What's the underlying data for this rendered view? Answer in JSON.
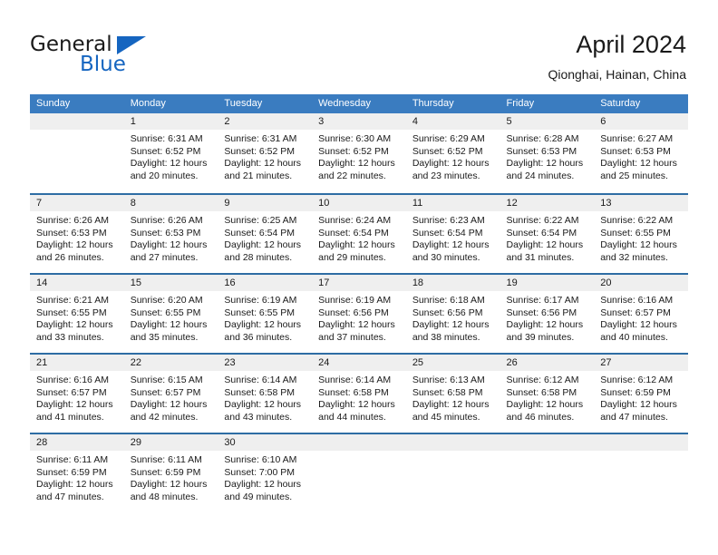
{
  "brand": {
    "name_primary": "General",
    "name_secondary": "Blue",
    "triangle_color": "#1565c0"
  },
  "header": {
    "title": "April 2024",
    "subtitle": "Qionghai, Hainan, China"
  },
  "theme": {
    "header_row_bg": "#3a7cc0",
    "week_separator": "#2e6da4",
    "day_number_bg": "#efefef",
    "text": "#1a1a1a"
  },
  "weekdays": [
    "Sunday",
    "Monday",
    "Tuesday",
    "Wednesday",
    "Thursday",
    "Friday",
    "Saturday"
  ],
  "weeks": [
    [
      {
        "day": "",
        "sunrise": "",
        "sunset": "",
        "daylight_line1": "",
        "daylight_line2": ""
      },
      {
        "day": "1",
        "sunrise": "Sunrise: 6:31 AM",
        "sunset": "Sunset: 6:52 PM",
        "daylight_line1": "Daylight: 12 hours",
        "daylight_line2": "and 20 minutes."
      },
      {
        "day": "2",
        "sunrise": "Sunrise: 6:31 AM",
        "sunset": "Sunset: 6:52 PM",
        "daylight_line1": "Daylight: 12 hours",
        "daylight_line2": "and 21 minutes."
      },
      {
        "day": "3",
        "sunrise": "Sunrise: 6:30 AM",
        "sunset": "Sunset: 6:52 PM",
        "daylight_line1": "Daylight: 12 hours",
        "daylight_line2": "and 22 minutes."
      },
      {
        "day": "4",
        "sunrise": "Sunrise: 6:29 AM",
        "sunset": "Sunset: 6:52 PM",
        "daylight_line1": "Daylight: 12 hours",
        "daylight_line2": "and 23 minutes."
      },
      {
        "day": "5",
        "sunrise": "Sunrise: 6:28 AM",
        "sunset": "Sunset: 6:53 PM",
        "daylight_line1": "Daylight: 12 hours",
        "daylight_line2": "and 24 minutes."
      },
      {
        "day": "6",
        "sunrise": "Sunrise: 6:27 AM",
        "sunset": "Sunset: 6:53 PM",
        "daylight_line1": "Daylight: 12 hours",
        "daylight_line2": "and 25 minutes."
      }
    ],
    [
      {
        "day": "7",
        "sunrise": "Sunrise: 6:26 AM",
        "sunset": "Sunset: 6:53 PM",
        "daylight_line1": "Daylight: 12 hours",
        "daylight_line2": "and 26 minutes."
      },
      {
        "day": "8",
        "sunrise": "Sunrise: 6:26 AM",
        "sunset": "Sunset: 6:53 PM",
        "daylight_line1": "Daylight: 12 hours",
        "daylight_line2": "and 27 minutes."
      },
      {
        "day": "9",
        "sunrise": "Sunrise: 6:25 AM",
        "sunset": "Sunset: 6:54 PM",
        "daylight_line1": "Daylight: 12 hours",
        "daylight_line2": "and 28 minutes."
      },
      {
        "day": "10",
        "sunrise": "Sunrise: 6:24 AM",
        "sunset": "Sunset: 6:54 PM",
        "daylight_line1": "Daylight: 12 hours",
        "daylight_line2": "and 29 minutes."
      },
      {
        "day": "11",
        "sunrise": "Sunrise: 6:23 AM",
        "sunset": "Sunset: 6:54 PM",
        "daylight_line1": "Daylight: 12 hours",
        "daylight_line2": "and 30 minutes."
      },
      {
        "day": "12",
        "sunrise": "Sunrise: 6:22 AM",
        "sunset": "Sunset: 6:54 PM",
        "daylight_line1": "Daylight: 12 hours",
        "daylight_line2": "and 31 minutes."
      },
      {
        "day": "13",
        "sunrise": "Sunrise: 6:22 AM",
        "sunset": "Sunset: 6:55 PM",
        "daylight_line1": "Daylight: 12 hours",
        "daylight_line2": "and 32 minutes."
      }
    ],
    [
      {
        "day": "14",
        "sunrise": "Sunrise: 6:21 AM",
        "sunset": "Sunset: 6:55 PM",
        "daylight_line1": "Daylight: 12 hours",
        "daylight_line2": "and 33 minutes."
      },
      {
        "day": "15",
        "sunrise": "Sunrise: 6:20 AM",
        "sunset": "Sunset: 6:55 PM",
        "daylight_line1": "Daylight: 12 hours",
        "daylight_line2": "and 35 minutes."
      },
      {
        "day": "16",
        "sunrise": "Sunrise: 6:19 AM",
        "sunset": "Sunset: 6:55 PM",
        "daylight_line1": "Daylight: 12 hours",
        "daylight_line2": "and 36 minutes."
      },
      {
        "day": "17",
        "sunrise": "Sunrise: 6:19 AM",
        "sunset": "Sunset: 6:56 PM",
        "daylight_line1": "Daylight: 12 hours",
        "daylight_line2": "and 37 minutes."
      },
      {
        "day": "18",
        "sunrise": "Sunrise: 6:18 AM",
        "sunset": "Sunset: 6:56 PM",
        "daylight_line1": "Daylight: 12 hours",
        "daylight_line2": "and 38 minutes."
      },
      {
        "day": "19",
        "sunrise": "Sunrise: 6:17 AM",
        "sunset": "Sunset: 6:56 PM",
        "daylight_line1": "Daylight: 12 hours",
        "daylight_line2": "and 39 minutes."
      },
      {
        "day": "20",
        "sunrise": "Sunrise: 6:16 AM",
        "sunset": "Sunset: 6:57 PM",
        "daylight_line1": "Daylight: 12 hours",
        "daylight_line2": "and 40 minutes."
      }
    ],
    [
      {
        "day": "21",
        "sunrise": "Sunrise: 6:16 AM",
        "sunset": "Sunset: 6:57 PM",
        "daylight_line1": "Daylight: 12 hours",
        "daylight_line2": "and 41 minutes."
      },
      {
        "day": "22",
        "sunrise": "Sunrise: 6:15 AM",
        "sunset": "Sunset: 6:57 PM",
        "daylight_line1": "Daylight: 12 hours",
        "daylight_line2": "and 42 minutes."
      },
      {
        "day": "23",
        "sunrise": "Sunrise: 6:14 AM",
        "sunset": "Sunset: 6:58 PM",
        "daylight_line1": "Daylight: 12 hours",
        "daylight_line2": "and 43 minutes."
      },
      {
        "day": "24",
        "sunrise": "Sunrise: 6:14 AM",
        "sunset": "Sunset: 6:58 PM",
        "daylight_line1": "Daylight: 12 hours",
        "daylight_line2": "and 44 minutes."
      },
      {
        "day": "25",
        "sunrise": "Sunrise: 6:13 AM",
        "sunset": "Sunset: 6:58 PM",
        "daylight_line1": "Daylight: 12 hours",
        "daylight_line2": "and 45 minutes."
      },
      {
        "day": "26",
        "sunrise": "Sunrise: 6:12 AM",
        "sunset": "Sunset: 6:58 PM",
        "daylight_line1": "Daylight: 12 hours",
        "daylight_line2": "and 46 minutes."
      },
      {
        "day": "27",
        "sunrise": "Sunrise: 6:12 AM",
        "sunset": "Sunset: 6:59 PM",
        "daylight_line1": "Daylight: 12 hours",
        "daylight_line2": "and 47 minutes."
      }
    ],
    [
      {
        "day": "28",
        "sunrise": "Sunrise: 6:11 AM",
        "sunset": "Sunset: 6:59 PM",
        "daylight_line1": "Daylight: 12 hours",
        "daylight_line2": "and 47 minutes."
      },
      {
        "day": "29",
        "sunrise": "Sunrise: 6:11 AM",
        "sunset": "Sunset: 6:59 PM",
        "daylight_line1": "Daylight: 12 hours",
        "daylight_line2": "and 48 minutes."
      },
      {
        "day": "30",
        "sunrise": "Sunrise: 6:10 AM",
        "sunset": "Sunset: 7:00 PM",
        "daylight_line1": "Daylight: 12 hours",
        "daylight_line2": "and 49 minutes."
      },
      {
        "day": "",
        "sunrise": "",
        "sunset": "",
        "daylight_line1": "",
        "daylight_line2": ""
      },
      {
        "day": "",
        "sunrise": "",
        "sunset": "",
        "daylight_line1": "",
        "daylight_line2": ""
      },
      {
        "day": "",
        "sunrise": "",
        "sunset": "",
        "daylight_line1": "",
        "daylight_line2": ""
      },
      {
        "day": "",
        "sunrise": "",
        "sunset": "",
        "daylight_line1": "",
        "daylight_line2": ""
      }
    ]
  ]
}
